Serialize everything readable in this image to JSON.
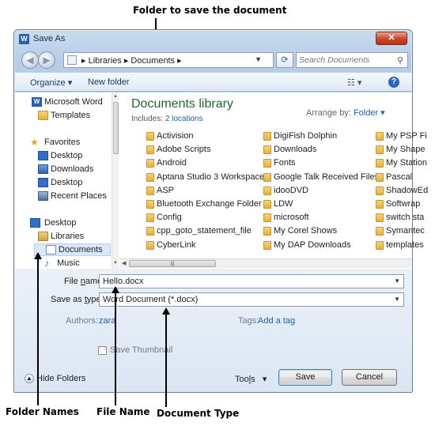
{
  "annotations": {
    "top": "Folder to save the document",
    "bottom_folder_names": "Folder Names",
    "bottom_file_name": "File Name",
    "bottom_document_type": "Document Type"
  },
  "window": {
    "title": "Save As",
    "close_glyph": "✕"
  },
  "address": {
    "path": "▸ Libraries ▸ Documents ▸",
    "search_placeholder": "Search Documents"
  },
  "toolbar": {
    "organize": "Organize ▾",
    "new_folder": "New folder"
  },
  "nav": {
    "items": [
      {
        "label": "Microsoft Word",
        "icon": "word-icon"
      },
      {
        "label": "Templates",
        "icon": "folder-icon"
      },
      {
        "label": "Favorites",
        "icon": "star-icon"
      },
      {
        "label": "Desktop",
        "icon": "desktop-icon"
      },
      {
        "label": "Downloads",
        "icon": "downloads-icon"
      },
      {
        "label": "Desktop",
        "icon": "desktop-icon"
      },
      {
        "label": "Recent Places",
        "icon": "recent-places-icon"
      },
      {
        "label": "Desktop",
        "icon": "desktop-icon"
      },
      {
        "label": "Libraries",
        "icon": "libraries-icon"
      },
      {
        "label": "Documents",
        "icon": "documents-icon"
      },
      {
        "label": "Music",
        "icon": "music-icon"
      }
    ]
  },
  "library": {
    "title": "Documents library",
    "includes_label": "Includes:",
    "includes_link": "2 locations",
    "arrange_label": "Arrange by:",
    "arrange_value": "Folder ▾"
  },
  "folders": {
    "col1": [
      "Activision",
      "Adobe Scripts",
      "Android",
      "Aptana Studio 3 Workspace",
      "ASP",
      "Bluetooth Exchange Folder",
      "Config",
      "cpp_goto_statement_file",
      "CyberLink"
    ],
    "col2": [
      "DigiFish Dolphin",
      "Downloads",
      "Fonts",
      "Google Talk Received Files",
      "idooDVD",
      "LDW",
      "microsoft",
      "My Corel Shows",
      "My DAP Downloads"
    ],
    "col3": [
      "My PSP Fi",
      "My Shape",
      "My Station",
      "Pascal",
      "ShadowEd",
      "Softwrap",
      "switch sta",
      "Symantec",
      "templates"
    ]
  },
  "fileinfo": {
    "file_name_label_pre": "File ",
    "file_name_label_u": "n",
    "file_name_label_post": "ame:",
    "file_name_value": "Hello.docx",
    "save_type_label_pre": "Save as ",
    "save_type_label_u": "t",
    "save_type_label_post": "ype:",
    "save_type_value": "Word Document (*.docx)",
    "authors_label": "Authors:",
    "authors_value": "zara",
    "tags_label": "Tags:",
    "tags_value": "Add a tag",
    "thumbnail_label": "Save Thumbnail",
    "hide_folders": "Hide Folders",
    "tools_pre": "Too",
    "tools_u": "l",
    "tools_post": "s",
    "save": "Save",
    "cancel": "Cancel"
  }
}
